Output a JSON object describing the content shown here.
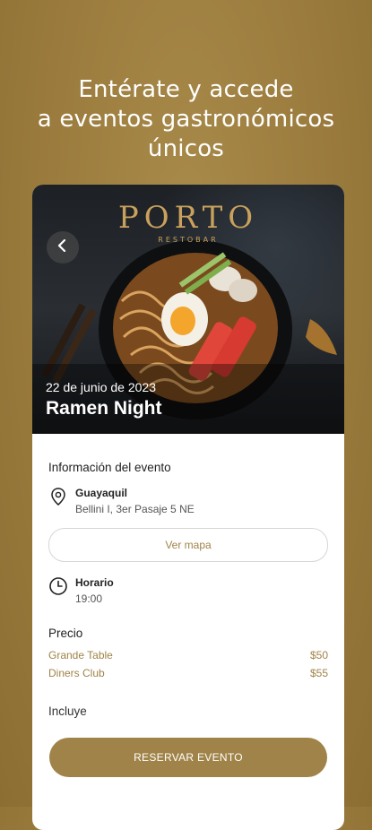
{
  "headline": {
    "line1": "Entérate y accede",
    "line2": "a eventos gastronómicos",
    "line3": "únicos"
  },
  "hero": {
    "logo_main": "PORTO",
    "logo_sub": "RESTOBAR",
    "date": "22 de junio de 2023",
    "title": "Ramen Night"
  },
  "info": {
    "section_title": "Información del evento",
    "location_city": "Guayaquil",
    "location_address": "Bellini I, 3er Pasaje 5 NE",
    "map_button": "Ver mapa",
    "schedule_label": "Horario",
    "schedule_time": "19:00"
  },
  "pricing": {
    "title": "Precio",
    "items": [
      {
        "name": "Grande Table",
        "price": "$50"
      },
      {
        "name": "Diners Club",
        "price": "$55"
      }
    ]
  },
  "includes_title": "Incluye",
  "reserve_button": "RESERVAR EVENTO",
  "colors": {
    "background": "#9a7b3d",
    "accent": "#a08348",
    "logo_gold": "#c9a15c"
  },
  "icons": [
    "back-chevron-icon",
    "location-pin-icon",
    "clock-icon"
  ]
}
